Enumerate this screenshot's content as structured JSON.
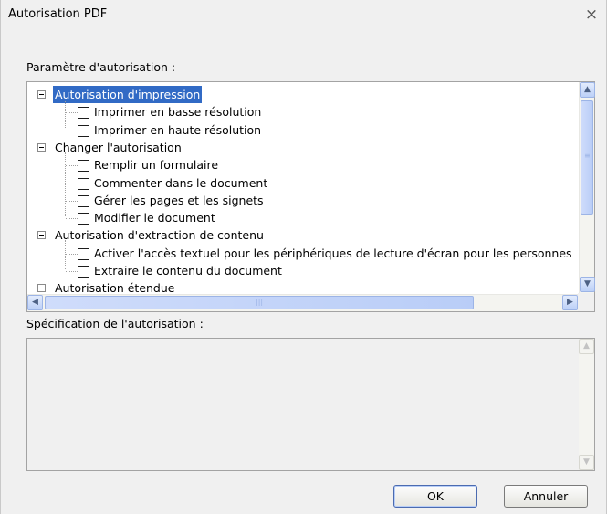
{
  "window": {
    "title": "Autorisation PDF",
    "close_glyph": "×"
  },
  "permissions": {
    "label": "Paramètre d'autorisation :",
    "groups": [
      {
        "label": "Autorisation d'impression",
        "selected": true,
        "items": [
          "Imprimer en basse résolution",
          "Imprimer en haute résolution"
        ]
      },
      {
        "label": "Changer l'autorisation",
        "selected": false,
        "items": [
          "Remplir un formulaire",
          "Commenter dans le document",
          "Gérer les pages et les signets",
          "Modifier le document"
        ]
      },
      {
        "label": "Autorisation d'extraction de contenu",
        "selected": false,
        "items": [
          "Activer l'accès textuel pour les périphériques de lecture d'écran pour les personnes",
          "Extraire le contenu du document"
        ]
      },
      {
        "label": "Autorisation étendue",
        "selected": false,
        "items": []
      }
    ]
  },
  "specification": {
    "label": "Spécification de l'autorisation :"
  },
  "buttons": {
    "ok": "OK",
    "cancel": "Annuler"
  },
  "icons": {
    "expander": "minus-box-icon",
    "scroll_up": "arrow-up-icon",
    "scroll_down": "arrow-down-icon",
    "scroll_left": "arrow-left-icon",
    "scroll_right": "arrow-right-icon"
  },
  "colors": {
    "selection": "#316ac5",
    "scrollbar": "#bcd0f7"
  }
}
